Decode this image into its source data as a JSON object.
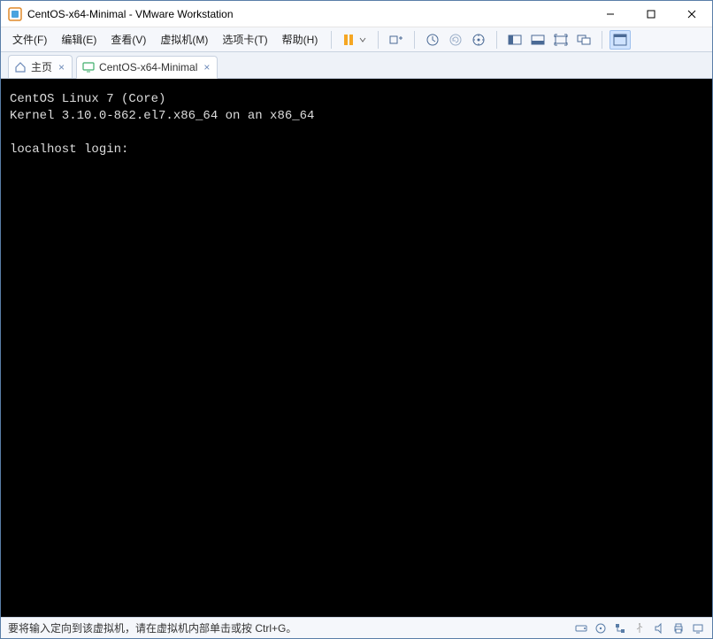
{
  "window": {
    "title": "CentOS-x64-Minimal - VMware Workstation"
  },
  "menus": {
    "file": "文件(F)",
    "edit": "编辑(E)",
    "view": "查看(V)",
    "vm": "虚拟机(M)",
    "tabs": "选项卡(T)",
    "help": "帮助(H)"
  },
  "tabs": {
    "home": "主页",
    "vm_name": "CentOS-x64-Minimal"
  },
  "console": {
    "line1": "CentOS Linux 7 (Core)",
    "line2": "Kernel 3.10.0-862.el7.x86_64 on an x86_64",
    "blank": "",
    "prompt": "localhost login:"
  },
  "status": {
    "text": "要将输入定向到该虚拟机，请在虚拟机内部单击或按 Ctrl+G。"
  },
  "icons": {
    "app": "vmware-icon",
    "home": "home-icon",
    "monitor": "monitor-icon"
  }
}
